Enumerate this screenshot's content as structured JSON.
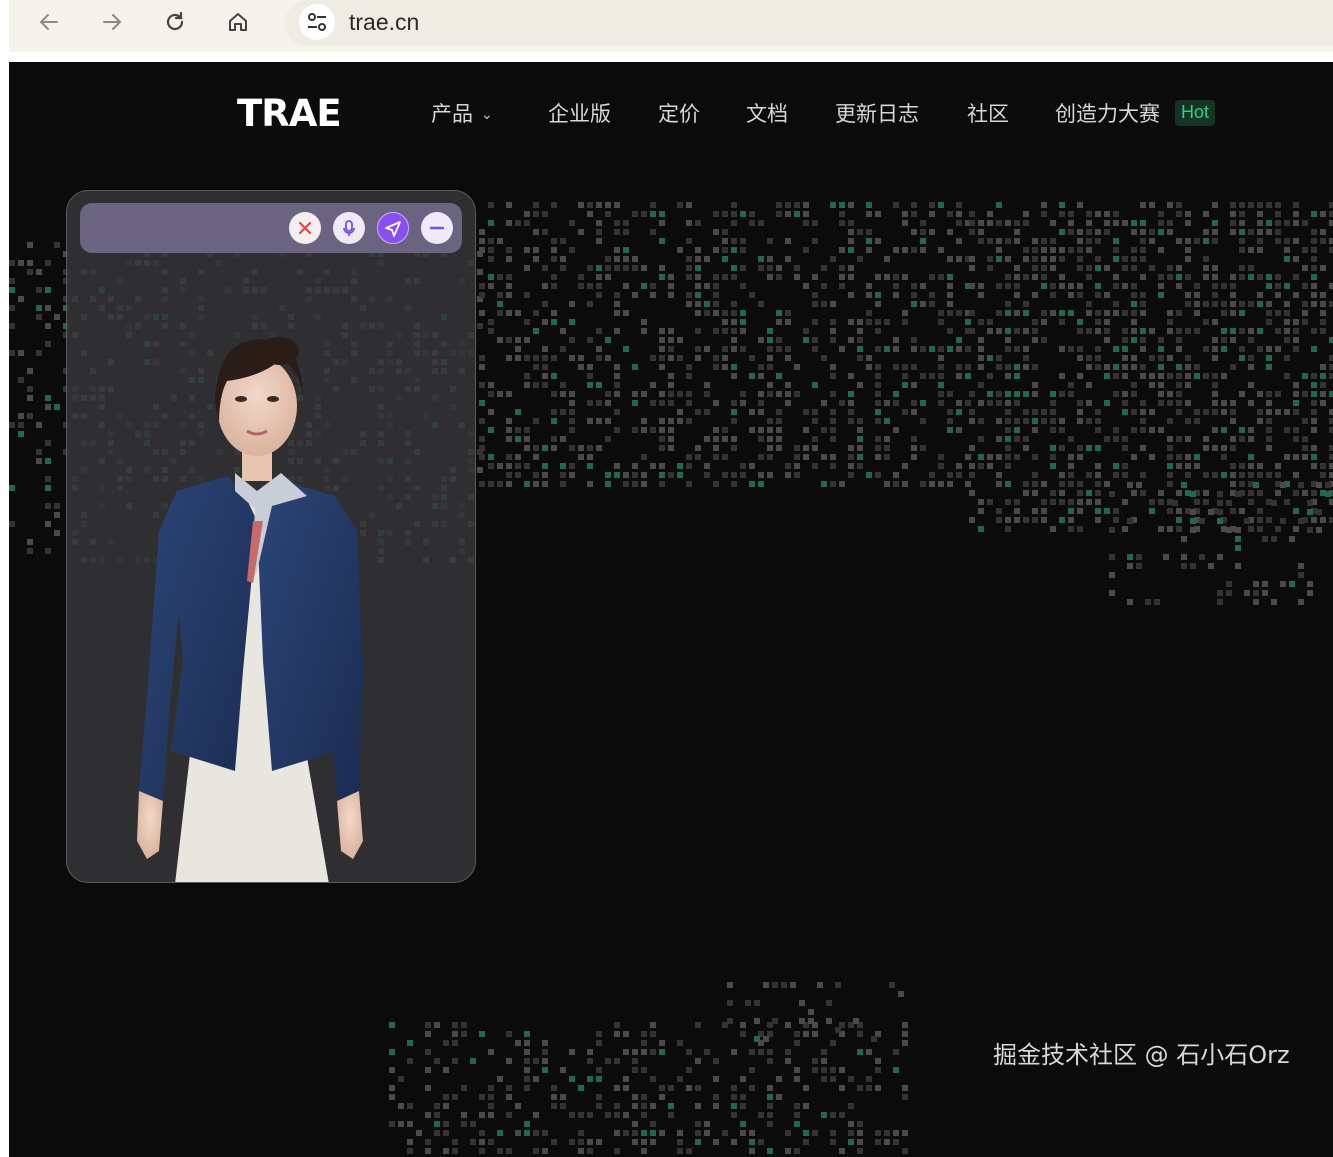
{
  "browser": {
    "url": "trae.cn"
  },
  "site": {
    "logo_text": "TRAE",
    "nav": [
      {
        "label": "产品"
      },
      {
        "label": "企业版"
      },
      {
        "label": "定价"
      },
      {
        "label": "文档"
      },
      {
        "label": "更新日志"
      },
      {
        "label": "社区"
      },
      {
        "label": "创造力大赛"
      }
    ],
    "hot_badge": "Hot"
  },
  "avatar_widget": {
    "buttons": [
      "close-icon",
      "microphone-icon",
      "send-icon",
      "minimize-icon"
    ]
  },
  "watermark": "掘金技术社区 @ 石小石Orz",
  "colors": {
    "page_bg": "#0b0b0b",
    "accent_green": "#33d17f",
    "send_purple": "#8a4df0"
  }
}
